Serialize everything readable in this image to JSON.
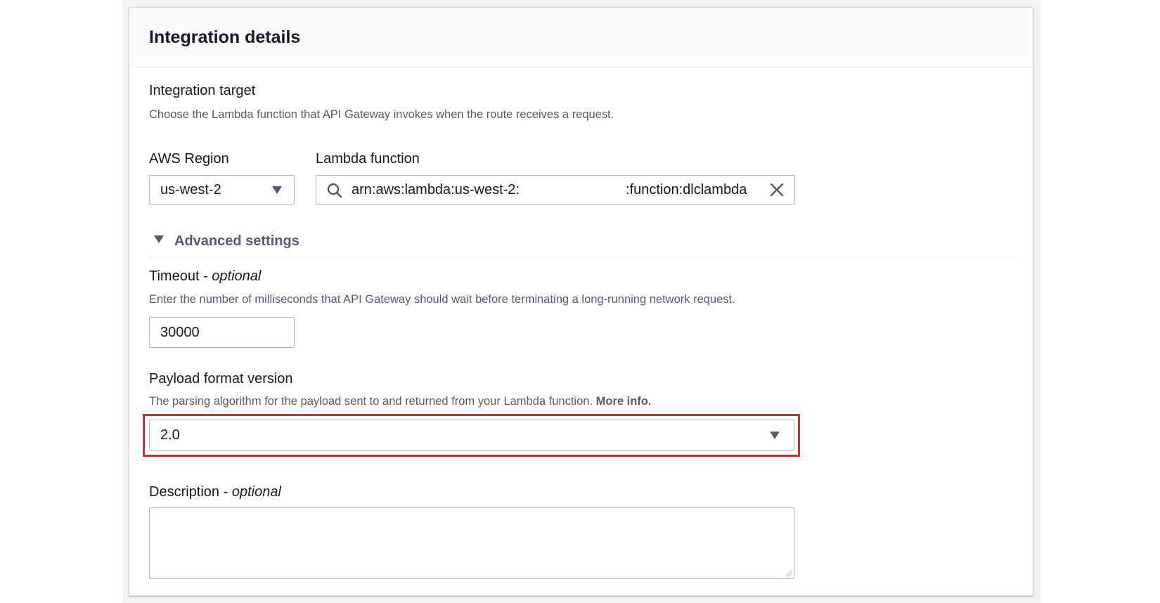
{
  "panel": {
    "title": "Integration details"
  },
  "integration_target": {
    "label": "Integration target",
    "description": "Choose the Lambda function that API Gateway invokes when the route receives a request."
  },
  "region": {
    "label": "AWS Region",
    "value": "us-west-2"
  },
  "lambda": {
    "label": "Lambda function",
    "value_prefix": "arn:aws:lambda:us-west-2:",
    "value_suffix": ":function:dlclambda"
  },
  "advanced": {
    "label": "Advanced settings"
  },
  "timeout": {
    "label": "Timeout",
    "label_suffix": "optional",
    "description": "Enter the number of milliseconds that API Gateway should wait before terminating a long-running network request.",
    "value": "30000"
  },
  "payload": {
    "label": "Payload format version",
    "description": "The parsing algorithm for the payload sent to and returned from your Lambda function.",
    "more_info": "More info.",
    "value": "2.0"
  },
  "description_field": {
    "label": "Description",
    "label_suffix": "optional",
    "value": ""
  },
  "colors": {
    "highlight": "#e8241f",
    "text": "#16191f",
    "muted": "#545b64"
  }
}
